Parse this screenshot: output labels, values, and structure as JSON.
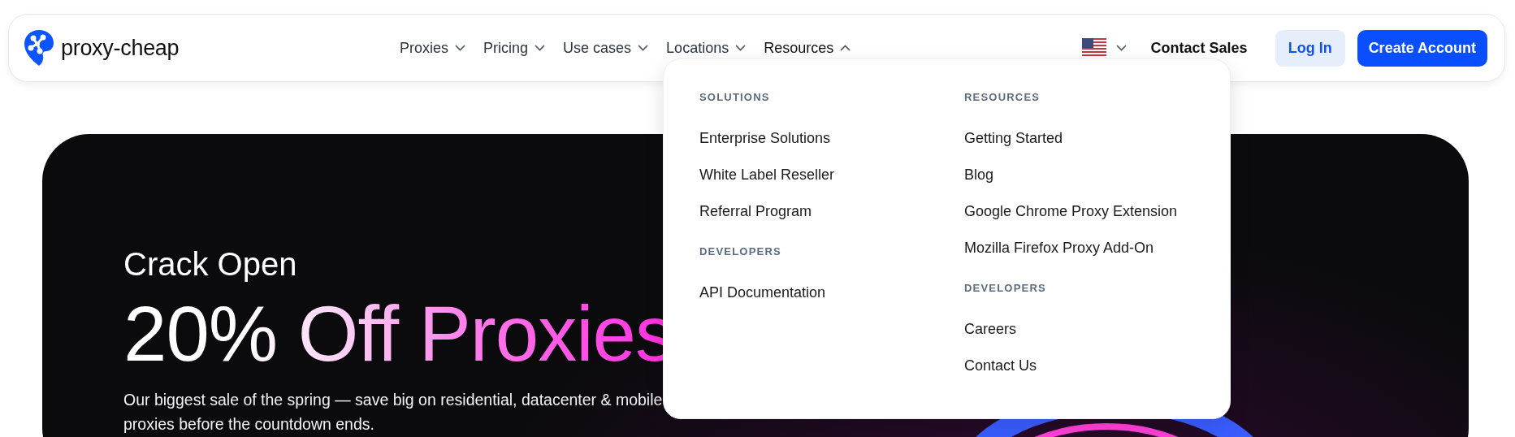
{
  "header": {
    "logo_text": "proxy-cheap",
    "nav": [
      {
        "label": "Proxies",
        "expanded": false
      },
      {
        "label": "Pricing",
        "expanded": false
      },
      {
        "label": "Use cases",
        "expanded": false
      },
      {
        "label": "Locations",
        "expanded": false
      },
      {
        "label": "Resources",
        "expanded": true
      }
    ],
    "contact_sales": "Contact Sales",
    "login": "Log In",
    "create_account": "Create Account"
  },
  "dropdown": {
    "columns": [
      {
        "sections": [
          {
            "heading": "SOLUTIONS",
            "items": [
              "Enterprise Solutions",
              "White Label Reseller",
              "Referral Program"
            ]
          },
          {
            "heading": "DEVELOPERS",
            "items": [
              "API Documentation"
            ]
          }
        ]
      },
      {
        "sections": [
          {
            "heading": "RESOURCES",
            "items": [
              "Getting Started",
              "Blog",
              "Google Chrome Proxy Extension",
              "Mozilla Firefox Proxy Add-On"
            ]
          },
          {
            "heading": "DEVELOPERS",
            "items": [
              "Careers",
              "Contact Us"
            ]
          }
        ]
      }
    ]
  },
  "hero": {
    "kicker": "Crack Open",
    "headline": "20% Off Proxies",
    "description": "Our biggest sale of the spring — save big on residential, datacenter & mobile proxies before the countdown ends."
  }
}
